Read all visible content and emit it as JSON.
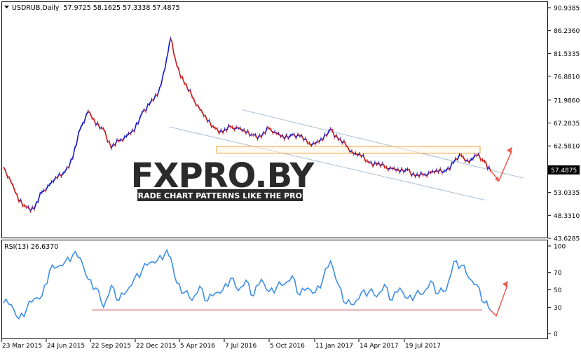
{
  "window": {
    "symbol_header": "USDRUB,Daily  57.9725 58.1625 57.3338 57.4875",
    "current_price_label": "57.4875"
  },
  "watermark": {
    "brand": "FXPRO.BY",
    "tagline": "TRADE CHART PATTERNS LIKE THE PROS"
  },
  "colors": {
    "background": "#ffffff",
    "axis": "#000000",
    "up_candle": "#1a1acc",
    "down_candle": "#cc1a1a",
    "rsi_line": "#3d8ee8",
    "channel_line": "#a9bfd6",
    "resistance_zone": "#f0a030",
    "rsi_support_line": "#c04040",
    "forecast_arrow": "#f05a4a",
    "price_tag_bg": "#000000",
    "watermark": "#2b2b2b"
  },
  "chart_data": [
    {
      "type": "line",
      "name": "price",
      "title": "USDRUB,Daily",
      "header_values": {
        "open": 57.9725,
        "high": 58.1625,
        "low": 57.3338,
        "close": 57.4875
      },
      "x_tick_labels": [
        "23 Mar 2015",
        "24 Jun 2015",
        "22 Sep 2015",
        "22 Dec 2015",
        "5 Apr 2016",
        "7 Jul 2016",
        "5 Oct 2016",
        "11 Jan 2017",
        "14 Apr 2017",
        "19 Jul 2017"
      ],
      "y_tick_labels": [
        "90.9385",
        "86.2360",
        "81.5335",
        "76.8810",
        "71.9860",
        "67.2835",
        "62.5810",
        "57.4875",
        "53.0335",
        "48.3310",
        "43.6285"
      ],
      "ylim": [
        43.6285,
        90.9385
      ],
      "x": [
        "2015-03-23",
        "2015-04-06",
        "2015-04-20",
        "2015-05-04",
        "2015-05-18",
        "2015-06-01",
        "2015-06-15",
        "2015-06-29",
        "2015-07-13",
        "2015-07-27",
        "2015-08-10",
        "2015-08-24",
        "2015-09-07",
        "2015-09-21",
        "2015-10-05",
        "2015-10-19",
        "2015-11-02",
        "2015-11-16",
        "2015-11-30",
        "2015-12-14",
        "2015-12-28",
        "2016-01-11",
        "2016-01-21",
        "2016-02-01",
        "2016-02-15",
        "2016-02-29",
        "2016-03-14",
        "2016-03-28",
        "2016-04-11",
        "2016-04-25",
        "2016-05-09",
        "2016-05-23",
        "2016-06-06",
        "2016-06-20",
        "2016-07-04",
        "2016-07-18",
        "2016-08-01",
        "2016-08-15",
        "2016-08-29",
        "2016-09-12",
        "2016-09-26",
        "2016-10-10",
        "2016-10-24",
        "2016-11-07",
        "2016-11-21",
        "2016-12-05",
        "2016-12-19",
        "2017-01-02",
        "2017-01-16",
        "2017-01-30",
        "2017-02-13",
        "2017-02-27",
        "2017-03-13",
        "2017-03-27",
        "2017-04-10",
        "2017-04-24",
        "2017-05-08",
        "2017-05-22",
        "2017-06-05",
        "2017-06-19",
        "2017-07-03",
        "2017-07-17",
        "2017-07-31",
        "2017-08-14",
        "2017-08-25"
      ],
      "close": [
        58.3,
        55.1,
        51.2,
        50.0,
        49.6,
        53.1,
        54.6,
        56.0,
        57.3,
        60.1,
        66.2,
        69.7,
        66.9,
        66.1,
        62.1,
        63.6,
        64.6,
        65.6,
        69.4,
        71.2,
        72.9,
        78.6,
        84.6,
        79.2,
        75.4,
        72.7,
        70.1,
        67.6,
        66.2,
        65.3,
        66.5,
        66.2,
        65.2,
        64.8,
        64.4,
        66.2,
        65.1,
        64.0,
        64.9,
        64.6,
        63.2,
        63.0,
        63.8,
        66.1,
        63.9,
        62.7,
        60.9,
        60.4,
        59.2,
        58.8,
        58.3,
        57.9,
        57.2,
        57.8,
        56.3,
        56.6,
        57.1,
        57.2,
        57.5,
        59.2,
        60.6,
        59.2,
        60.6,
        59.4,
        57.4875
      ]
    },
    {
      "type": "line",
      "name": "RSI(13)",
      "title": "RSI(13) 26.6370",
      "last_value": 26.637,
      "period": 13,
      "y_tick_labels": [
        "100",
        "70",
        "50",
        "30",
        "0"
      ],
      "ylim": [
        0,
        100
      ],
      "x": [
        "2015-03-23",
        "2015-04-06",
        "2015-04-20",
        "2015-05-04",
        "2015-05-18",
        "2015-06-01",
        "2015-06-15",
        "2015-06-29",
        "2015-07-13",
        "2015-07-27",
        "2015-08-10",
        "2015-08-24",
        "2015-09-07",
        "2015-09-21",
        "2015-10-05",
        "2015-10-19",
        "2015-11-02",
        "2015-11-16",
        "2015-11-30",
        "2015-12-14",
        "2015-12-28",
        "2016-01-11",
        "2016-01-21",
        "2016-02-01",
        "2016-02-15",
        "2016-02-29",
        "2016-03-14",
        "2016-03-28",
        "2016-04-11",
        "2016-04-25",
        "2016-05-09",
        "2016-05-23",
        "2016-06-06",
        "2016-06-20",
        "2016-07-04",
        "2016-07-18",
        "2016-08-01",
        "2016-08-15",
        "2016-08-29",
        "2016-09-12",
        "2016-09-26",
        "2016-10-10",
        "2016-10-24",
        "2016-11-07",
        "2016-11-21",
        "2016-12-05",
        "2016-12-19",
        "2017-01-02",
        "2017-01-16",
        "2017-01-30",
        "2017-02-13",
        "2017-02-27",
        "2017-03-13",
        "2017-03-27",
        "2017-04-10",
        "2017-04-24",
        "2017-05-08",
        "2017-05-22",
        "2017-06-05",
        "2017-06-19",
        "2017-07-03",
        "2017-07-17",
        "2017-07-31",
        "2017-08-14",
        "2017-08-25"
      ],
      "values": [
        35,
        33,
        17,
        28,
        40,
        43,
        72,
        76,
        82,
        90,
        86,
        62,
        52,
        30,
        55,
        38,
        48,
        63,
        72,
        81,
        84,
        92,
        87,
        58,
        47,
        38,
        54,
        37,
        46,
        50,
        63,
        49,
        61,
        43,
        62,
        48,
        53,
        56,
        66,
        44,
        52,
        47,
        62,
        83,
        56,
        34,
        33,
        47,
        48,
        42,
        56,
        38,
        52,
        40,
        44,
        45,
        60,
        46,
        49,
        82,
        78,
        63,
        56,
        35,
        26.637
      ]
    }
  ],
  "annotations": {
    "rsi_support_level": 27,
    "resistance_zone": [
      61.1,
      62.5
    ],
    "down_channel": {
      "upper": [
        [
          "2016-05-30",
          70.0
        ],
        [
          "2017-10-23",
          56.0
        ]
      ],
      "lower": [
        [
          "2016-01-18",
          66.5
        ],
        [
          "2017-08-14",
          51.5
        ]
      ]
    }
  }
}
